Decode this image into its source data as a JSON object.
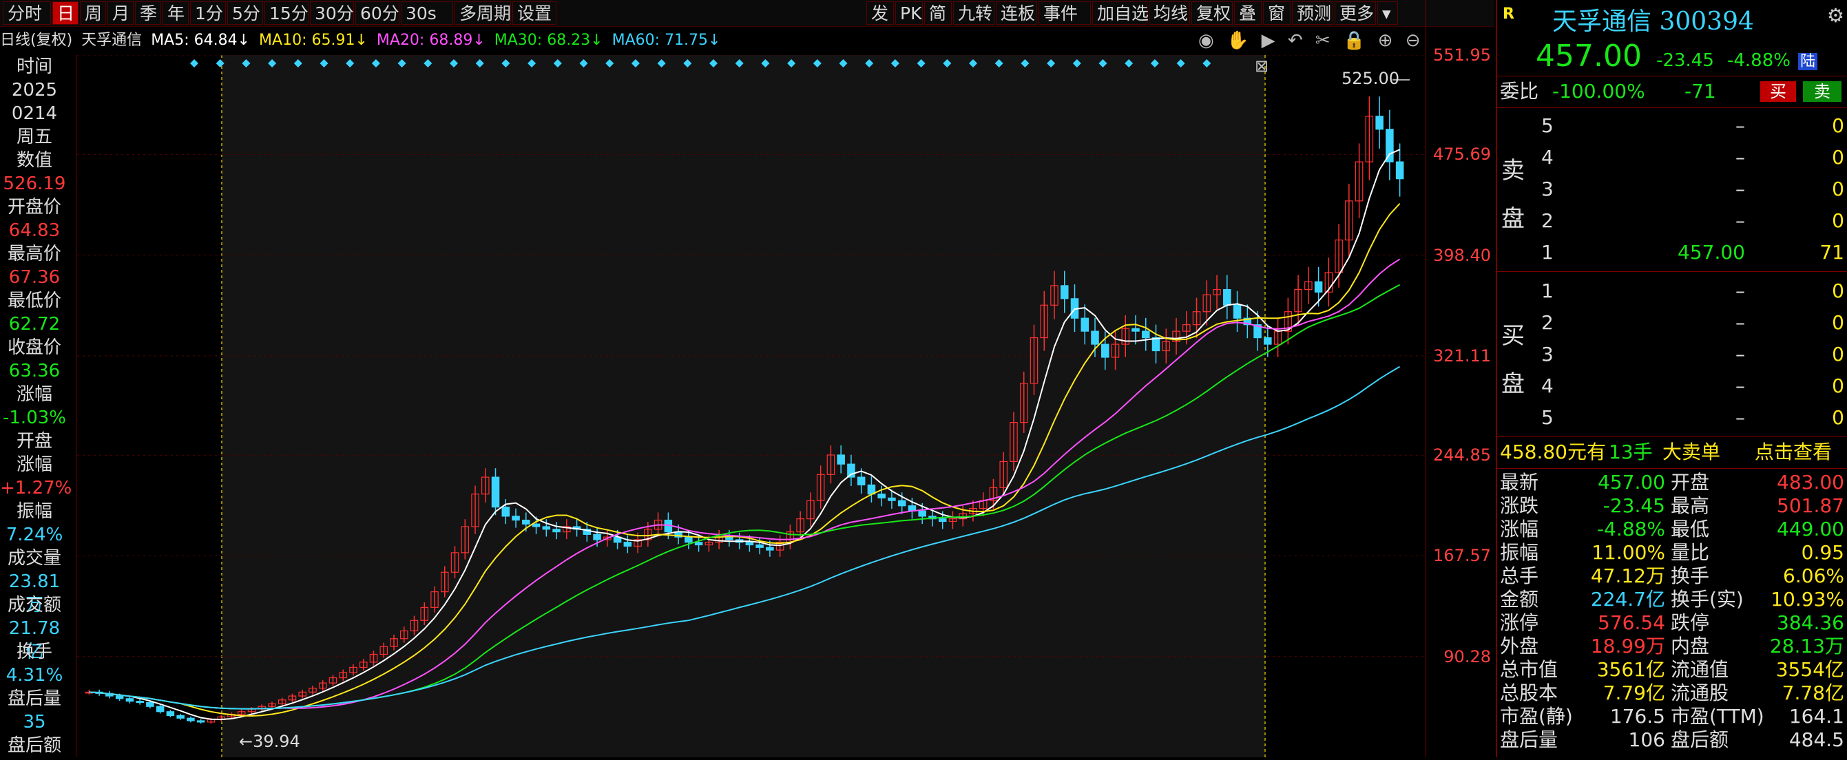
{
  "toolbar": {
    "left": [
      {
        "label": "分时",
        "active": false
      },
      {
        "label": "日",
        "active": true
      },
      {
        "label": "周",
        "active": false
      },
      {
        "label": "月",
        "active": false
      },
      {
        "label": "季",
        "active": false
      },
      {
        "label": "年",
        "active": false
      },
      {
        "label": "1分",
        "active": false
      },
      {
        "label": "5分",
        "active": false
      },
      {
        "label": "15分",
        "active": false
      },
      {
        "label": "30分",
        "active": false
      },
      {
        "label": "60分",
        "active": false
      },
      {
        "label": "30s",
        "active": false
      },
      {
        "label": "多周期",
        "active": false
      },
      {
        "label": "设置",
        "active": false
      }
    ],
    "right": [
      "发",
      "PK",
      "简",
      "九转",
      "连板",
      "事件",
      "加自选",
      "均线",
      "复权",
      "叠",
      "窗",
      "预测",
      "更多"
    ]
  },
  "ma_bar": {
    "prefix": "日线(复权)",
    "stock": "天孚通信",
    "ma5": "MA5: 64.84↓",
    "ma10": "MA10: 65.91↓",
    "ma20": "MA20: 68.89↓",
    "ma30": "MA30: 68.23↓",
    "ma60": "MA60: 71.75↓"
  },
  "left_panel": [
    {
      "text": "时间",
      "color": "white"
    },
    {
      "text": "2025",
      "color": "white"
    },
    {
      "text": "0214",
      "color": "white"
    },
    {
      "text": "周五",
      "color": "white"
    },
    {
      "text": "数值",
      "color": "white"
    },
    {
      "text": "526.19",
      "color": "red"
    },
    {
      "text": "开盘价",
      "color": "white"
    },
    {
      "text": "64.83",
      "color": "red"
    },
    {
      "text": "最高价",
      "color": "white"
    },
    {
      "text": "67.36",
      "color": "red"
    },
    {
      "text": "最低价",
      "color": "white"
    },
    {
      "text": "62.72",
      "color": "green"
    },
    {
      "text": "收盘价",
      "color": "white"
    },
    {
      "text": "63.36",
      "color": "green"
    },
    {
      "text": "涨幅",
      "color": "white"
    },
    {
      "text": "-1.03%",
      "color": "green"
    },
    {
      "text": "开盘",
      "color": "white"
    },
    {
      "text": "涨幅",
      "color": "white"
    },
    {
      "text": "+1.27%",
      "color": "red"
    },
    {
      "text": "振幅",
      "color": "white"
    },
    {
      "text": "7.24%",
      "color": "cyan"
    },
    {
      "text": "成交量",
      "color": "white"
    },
    {
      "text": "23.81万",
      "color": "cyan"
    },
    {
      "text": "成交额",
      "color": "white"
    },
    {
      "text": "21.78亿",
      "color": "cyan"
    },
    {
      "text": "换手",
      "color": "white"
    },
    {
      "text": "4.31%",
      "color": "cyan"
    },
    {
      "text": "盘后量",
      "color": "white"
    },
    {
      "text": "35",
      "color": "cyan"
    },
    {
      "text": "盘后额",
      "color": "white"
    }
  ],
  "y_ticks": [
    "551.95",
    "475.69",
    "398.40",
    "321.11",
    "244.85",
    "167.57",
    "90.28"
  ],
  "annotations": {
    "high": "525.00",
    "low": "←39.94"
  },
  "quote": {
    "name": "天孚通信",
    "code": "300394",
    "price": "457.00",
    "change": "-23.45",
    "change_pct": "-4.88%",
    "market_tag": "陆",
    "r_tag": "R",
    "weibi_label": "委比",
    "weibi_value": "-100.00%",
    "weibi_diff": "-71",
    "buy_btn": "买",
    "sell_btn": "卖"
  },
  "sell_book": {
    "label_top": "卖",
    "label_bottom": "盘",
    "rows": [
      {
        "level": "5",
        "price": "–",
        "vol": "0"
      },
      {
        "level": "4",
        "price": "–",
        "vol": "0"
      },
      {
        "level": "3",
        "price": "–",
        "vol": "0"
      },
      {
        "level": "2",
        "price": "–",
        "vol": "0"
      },
      {
        "level": "1",
        "price": "457.00",
        "vol": "71"
      }
    ]
  },
  "buy_book": {
    "label_top": "买",
    "label_bottom": "盘",
    "rows": [
      {
        "level": "1",
        "price": "–",
        "vol": "0"
      },
      {
        "level": "2",
        "price": "–",
        "vol": "0"
      },
      {
        "level": "3",
        "price": "–",
        "vol": "0"
      },
      {
        "level": "4",
        "price": "–",
        "vol": "0"
      },
      {
        "level": "5",
        "price": "–",
        "vol": "0"
      }
    ]
  },
  "big_order": {
    "amount": "458.80元有",
    "hands": "13手",
    "label": "大卖单",
    "link": "点击查看"
  },
  "stats": [
    {
      "l1": "最新",
      "v1": "457.00",
      "c1": "green",
      "l2": "开盘",
      "v2": "483.00",
      "c2": "red"
    },
    {
      "l1": "涨跌",
      "v1": "-23.45",
      "c1": "green",
      "l2": "最高",
      "v2": "501.87",
      "c2": "red"
    },
    {
      "l1": "涨幅",
      "v1": "-4.88%",
      "c1": "green",
      "l2": "最低",
      "v2": "449.00",
      "c2": "green"
    },
    {
      "l1": "振幅",
      "v1": "11.00%",
      "c1": "yellow",
      "l2": "量比",
      "v2": "0.95",
      "c2": "yellow"
    },
    {
      "l1": "总手",
      "v1": "47.12万",
      "c1": "yellow",
      "l2": "换手",
      "v2": "6.06%",
      "c2": "yellow"
    },
    {
      "l1": "金额",
      "v1": "224.7亿",
      "c1": "cyan",
      "l2": "换手(实)",
      "v2": "10.93%",
      "c2": "yellow"
    },
    {
      "l1": "涨停",
      "v1": "576.54",
      "c1": "red",
      "l2": "跌停",
      "v2": "384.36",
      "c2": "green"
    },
    {
      "l1": "外盘",
      "v1": "18.99万",
      "c1": "red",
      "l2": "内盘",
      "v2": "28.13万",
      "c2": "green"
    },
    {
      "l1": "总市值",
      "v1": "3561亿",
      "c1": "yellow",
      "l2": "流通值",
      "v2": "3554亿",
      "c2": "yellow"
    },
    {
      "l1": "总股本",
      "v1": "7.79亿",
      "c1": "yellow",
      "l2": "流通股",
      "v2": "7.78亿",
      "c2": "yellow"
    },
    {
      "l1": "市盈(静)",
      "v1": "176.5",
      "c1": "white",
      "l2": "市盈(TTM)",
      "v2": "164.1",
      "c2": "white"
    },
    {
      "l1": "盘后量",
      "v1": "106",
      "c1": "white",
      "l2": "盘后额",
      "v2": "484.5",
      "c2": "white"
    }
  ],
  "chart_data": {
    "type": "candlestick",
    "y_range": [
      13.0,
      551.95
    ],
    "ma_lines": [
      "MA5",
      "MA10",
      "MA20",
      "MA30",
      "MA60"
    ],
    "ma_colors": {
      "MA5": "#ffffff",
      "MA10": "#ffe81a",
      "MA20": "#ff52ff",
      "MA30": "#19e619",
      "MA60": "#3bd4ff"
    },
    "close_series": [
      63,
      62,
      60,
      58,
      56,
      55,
      52,
      48,
      45,
      43,
      41,
      40,
      42,
      44,
      46,
      48,
      50,
      52,
      54,
      57,
      60,
      63,
      66,
      70,
      74,
      78,
      82,
      86,
      92,
      98,
      104,
      110,
      118,
      128,
      140,
      155,
      170,
      190,
      215,
      228,
      205,
      198,
      195,
      192,
      190,
      188,
      186,
      190,
      188,
      184,
      180,
      182,
      178,
      175,
      180,
      188,
      195,
      186,
      182,
      178,
      176,
      178,
      182,
      180,
      178,
      176,
      174,
      172,
      178,
      186,
      196,
      210,
      230,
      245,
      238,
      228,
      222,
      215,
      212,
      210,
      206,
      202,
      198,
      196,
      194,
      196,
      200,
      204,
      210,
      220,
      240,
      270,
      300,
      335,
      360,
      375,
      365,
      350,
      340,
      330,
      320,
      330,
      342,
      340,
      335,
      325,
      332,
      340,
      345,
      355,
      368,
      372,
      360,
      350,
      345,
      335,
      330,
      340,
      355,
      372,
      378,
      370,
      385,
      410,
      440,
      470,
      505,
      495,
      470,
      457
    ],
    "high_label": "525.00",
    "low_label": "39.94"
  }
}
